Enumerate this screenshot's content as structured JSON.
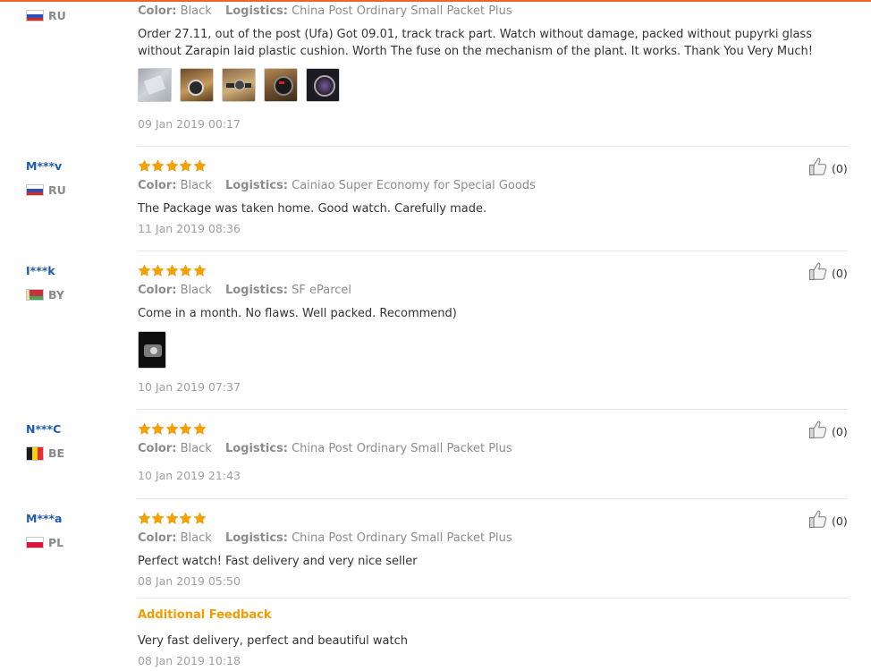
{
  "labels": {
    "color": "Color:",
    "logistics": "Logistics:",
    "additional_feedback": "Additional Feedback"
  },
  "colors": {
    "accent_orange": "#f59b00",
    "user_blue": "#1f5ca8",
    "star": "#f5a200"
  },
  "icons": {
    "star": "star-icon",
    "helpful": "thumbs-up-icon"
  },
  "reviews": [
    {
      "user": "",
      "country": "RU",
      "rating": null,
      "color": "Black",
      "logistics": "China Post Ordinary Small Packet Plus",
      "text": "Order 27.11, out of the post (Ufa) Got 09.01, track track part. Watch without damage, packed without pupyrki glass without Zarapin laid plastic cushion. Worth The fuse on the mechanism of the plant. It works. Thank You Very Much!",
      "photos": 5,
      "date": "09 Jan 2019 00:17"
    },
    {
      "user": "M***v",
      "country": "RU",
      "rating": 5,
      "helpful": "(0)",
      "color": "Black",
      "logistics": "Cainiao Super Economy for Special Goods",
      "text": "The Package was taken home. Good watch. Carefully made.",
      "date": "11 Jan 2019 08:36"
    },
    {
      "user": "I***k",
      "country": "BY",
      "rating": 5,
      "helpful": "(0)",
      "color": "Black",
      "logistics": "SF eParcel",
      "text": "Come in a month. No flaws. Well packed. Recommend)",
      "photos": 1,
      "date": "10 Jan 2019 07:37"
    },
    {
      "user": "N***C",
      "country": "BE",
      "rating": 5,
      "helpful": "(0)",
      "color": "Black",
      "logistics": "China Post Ordinary Small Packet Plus",
      "date": "10 Jan 2019 21:43"
    },
    {
      "user": "M***a",
      "country": "PL",
      "rating": 5,
      "helpful": "(0)",
      "color": "Black",
      "logistics": "China Post Ordinary Small Packet Plus",
      "text": "Perfect watch! Fast delivery and very nice seller",
      "date": "08 Jan 2019 05:50",
      "additional_feedback": {
        "text": "Very fast delivery, perfect and beautiful watch",
        "date": "08 Jan 2019 10:18"
      }
    }
  ]
}
